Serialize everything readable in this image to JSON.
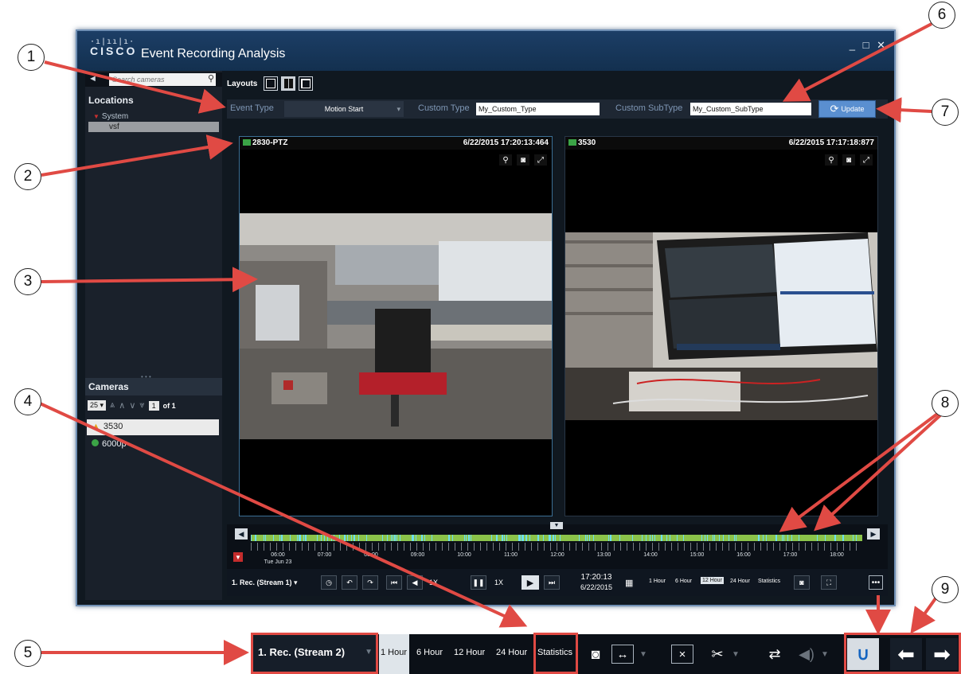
{
  "window": {
    "logo_bars": "·ı|ıı|ı·",
    "logo_word": "CISCO",
    "title": "Event Recording Analysis",
    "controls": "_ □ ✕"
  },
  "sidebar": {
    "search_placeholder": "Search cameras",
    "locations_heading": "Locations",
    "tree_root": "System",
    "tree_child": "vsf",
    "cameras_heading": "Cameras",
    "per_page": "25",
    "page_current": "1",
    "page_total": "of 1",
    "cameras": [
      {
        "name": "3530",
        "status": "warning"
      },
      {
        "name": "6000p",
        "status": "ok"
      }
    ]
  },
  "layouts_label": "Layouts",
  "event_filter": {
    "event_type_label": "Event Type",
    "event_type_value": "Motion Start",
    "custom_type_label": "Custom Type",
    "custom_type_value": "My_Custom_Type",
    "custom_subtype_label": "Custom SubType",
    "custom_subtype_value": "My_Custom_SubType",
    "update_label": "Update"
  },
  "tiles": [
    {
      "camera": "2830-PTZ",
      "timestamp": "6/22/2015 17:20:13:464"
    },
    {
      "camera": "3530",
      "timestamp": "6/22/2015 17:17:18:877"
    }
  ],
  "timeline": {
    "labels": [
      "06:00",
      "07:00",
      "08:00",
      "09:00",
      "10:00",
      "11:00",
      "12:00",
      "13:00",
      "14:00",
      "15:00",
      "16:00",
      "17:00",
      "18:00"
    ],
    "start_date": "Tue Jun 23"
  },
  "controls": {
    "stream_label": "1. Rec. (Stream 1)",
    "speed_back": "1X",
    "speed_fwd": "1X",
    "time": "17:20:13",
    "date": "6/22/2015",
    "ranges": [
      "1 Hour",
      "6 Hour",
      "12 Hour",
      "24 Hour"
    ],
    "selected_range": "12 Hour",
    "statistics": "Statistics",
    "more": "•••"
  },
  "strip": {
    "stream_label": "1. Rec. (Stream 2)",
    "ranges": [
      "1 Hour",
      "6 Hour",
      "12 Hour",
      "24 Hour"
    ],
    "selected_range": "1 Hour",
    "statistics": "Statistics"
  },
  "callouts": [
    "1",
    "2",
    "3",
    "4",
    "5",
    "6",
    "7",
    "8",
    "9"
  ],
  "colors": {
    "callout_arrow": "#e04a44",
    "timeline_bar": "#8bc34a",
    "timeline_events": "#6ee0f0",
    "update_button": "#5a8fd0"
  }
}
